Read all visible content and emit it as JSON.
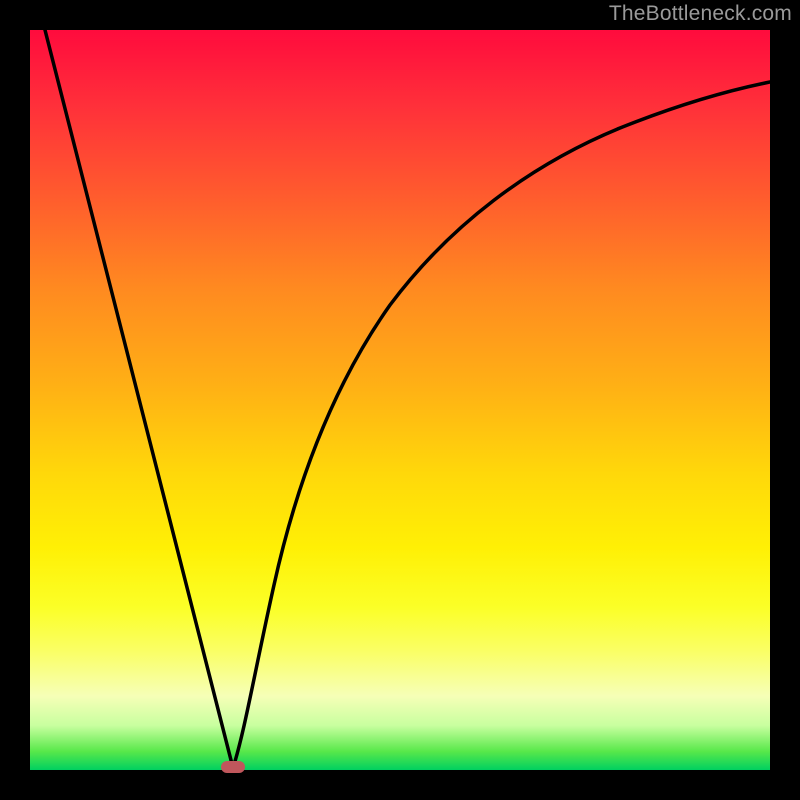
{
  "watermark": "TheBottleneck.com",
  "chart_data": {
    "type": "line",
    "title": "",
    "xlabel": "",
    "ylabel": "",
    "xlim": [
      0,
      100
    ],
    "ylim": [
      0,
      100
    ],
    "grid": false,
    "legend": false,
    "background_gradient": {
      "top": "#ff0b3d",
      "bottom": "#00d060",
      "stops": [
        "red",
        "orange",
        "yellow",
        "green"
      ]
    },
    "series": [
      {
        "name": "line-left",
        "x": [
          2,
          27.5
        ],
        "y": [
          100,
          0
        ]
      },
      {
        "name": "curve-right",
        "x": [
          27.5,
          30,
          33,
          37,
          42,
          48,
          55,
          63,
          72,
          82,
          92,
          100
        ],
        "y": [
          0,
          13,
          25,
          37,
          48,
          57,
          65,
          72,
          78,
          83,
          87,
          90
        ]
      }
    ],
    "annotations": [
      {
        "name": "marker",
        "x": 27.5,
        "y": 0,
        "shape": "rounded-rect",
        "color": "#c0575c"
      }
    ]
  }
}
